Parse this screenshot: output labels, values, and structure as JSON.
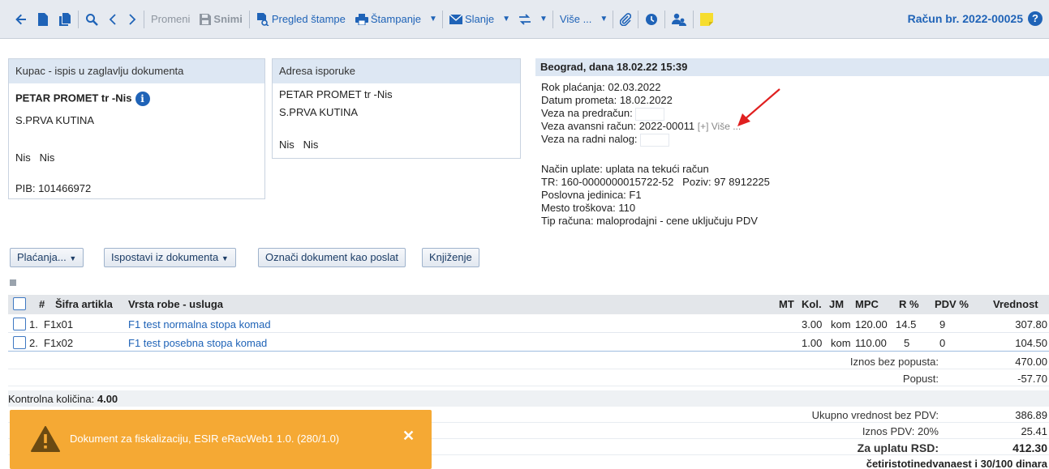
{
  "toolbar": {
    "edit_label": "Promeni",
    "save_label": "Snimi",
    "preview_label": "Pregled štampe",
    "print_label": "Štampanje",
    "send_label": "Slanje",
    "more_label": "Više ...",
    "document_title": "Račun br. 2022-00025"
  },
  "buyer": {
    "header": "Kupac - ispis u zaglavlju dokumenta",
    "name": "PETAR PROMET tr -Nis",
    "street": "S.PRVA KUTINA",
    "city": "Nis   Nis",
    "pib": "PIB: 101466972"
  },
  "delivery": {
    "header": "Adresa isporuke",
    "name": "PETAR PROMET tr -Nis",
    "street": "S.PRVA KUTINA",
    "city": "Nis   Nis"
  },
  "doc_info": {
    "header": "Beograd, dana 18.02.22 15:39",
    "due_date": "Rok plaćanja: 02.03.2022",
    "trade_date": "Datum prometa: 18.02.2022",
    "proforma_link": "Veza na predračun:",
    "advance_link": "Veza avansni račun: 2022-00011",
    "advance_more": "[+] Više ...",
    "work_order_link": "Veza na radni nalog:",
    "payment_method": "Način uplate: uplata na tekući račun",
    "account": "TR: 160-0000000015722-52   Poziv: 97 8912225",
    "business_unit": "Poslovna jedinica: F1",
    "cost_center": "Mesto troškova: 110",
    "invoice_type": "Tip računa: maloprodajni - cene uključuju PDV"
  },
  "actions": {
    "payments": "Plaćanja...",
    "issue_from": "Ispostavi iz dokumenta",
    "mark_sent": "Označi dokument kao poslat",
    "posting": "Knjiženje"
  },
  "table": {
    "headers": {
      "no": "#",
      "code": "Šifra artikla",
      "name": "Vrsta robe - usluga",
      "mt": "MT",
      "qty": "Kol.",
      "unit": "JM",
      "price": "MPC",
      "discount": "R %",
      "vat": "PDV %",
      "value": "Vrednost"
    },
    "rows": [
      {
        "no": "1.",
        "code": "F1x01",
        "name": "F1 test normalna stopa komad",
        "qty": "3.00",
        "unit": "kom",
        "price": "120.00",
        "discount": "14.5",
        "vat": "9",
        "value": "307.80"
      },
      {
        "no": "2.",
        "code": "F1x02",
        "name": "F1 test posebna stopa komad",
        "qty": "1.00",
        "unit": "kom",
        "price": "110.00",
        "discount": "5",
        "vat": "0",
        "value": "104.50"
      }
    ]
  },
  "totals": {
    "no_discount_label": "Iznos bez popusta:",
    "no_discount_value": "470.00",
    "discount_label": "Popust:",
    "discount_value": "-57.70",
    "control_qty_label": "Kontrolna količina:",
    "control_qty_value": "4.00",
    "net_label": "Ukupno vrednost bez PDV:",
    "net_value": "386.89",
    "vat_label": "Iznos PDV: 20%",
    "vat_value": "25.41",
    "payable_label": "Za uplatu RSD:",
    "payable_value": "412.30",
    "in_words": "četiristotinedvanaest i 30/100 dinara"
  },
  "toast": {
    "message": "Dokument za fiskalizaciju, ESIR eRacWeb1 1.0. (280/1.0)"
  },
  "colors": {
    "accent": "#1f63b7",
    "header_bg": "#dde7f3",
    "toast_bg": "#f5a934",
    "arrow": "#e02020"
  }
}
